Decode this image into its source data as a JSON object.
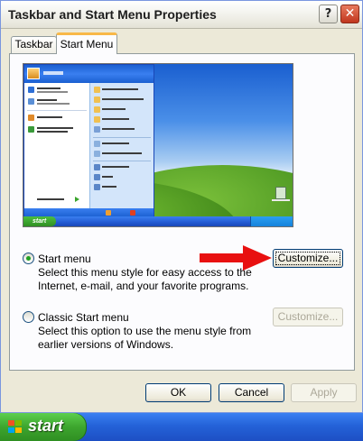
{
  "window": {
    "title": "Taskbar and Start Menu Properties",
    "help_glyph": "?",
    "close_glyph": "✕"
  },
  "tabs": [
    {
      "label": "Taskbar",
      "selected": false
    },
    {
      "label": "Start Menu",
      "selected": true
    }
  ],
  "options": {
    "start_menu": {
      "label": "Start menu",
      "selected": true,
      "description": "Select this menu style for easy access to the Internet, e-mail, and your favorite programs.",
      "button_label": "Customize...",
      "button_enabled": true
    },
    "classic": {
      "label": "Classic Start menu",
      "selected": false,
      "description": "Select this option to use the menu style from earlier versions of Windows.",
      "button_label": "Customize...",
      "button_enabled": false
    }
  },
  "buttons": {
    "ok": "OK",
    "cancel": "Cancel",
    "apply": "Apply",
    "apply_enabled": false
  },
  "taskbar": {
    "start_label": "start"
  },
  "colors": {
    "arrow": "#e81010",
    "start_green": "#3da52e",
    "taskbar_blue": "#2462d8",
    "radio_dot": "#21a121"
  }
}
